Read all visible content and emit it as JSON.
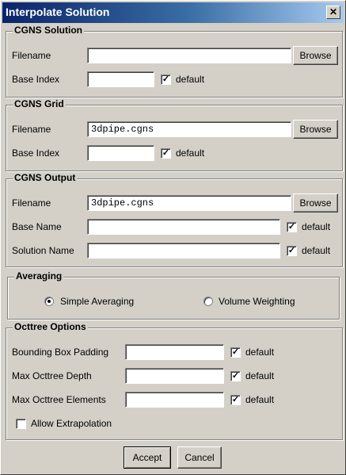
{
  "window": {
    "title": "Interpolate Solution",
    "close_glyph": "✕"
  },
  "cgns_solution": {
    "legend": "CGNS Solution",
    "filename_label": "Filename",
    "filename_value": "",
    "browse_label": "Browse",
    "base_index_label": "Base Index",
    "base_index_value": "",
    "default_label": "default",
    "default_checked": true
  },
  "cgns_grid": {
    "legend": "CGNS Grid",
    "filename_label": "Filename",
    "filename_value": "3dpipe.cgns",
    "browse_label": "Browse",
    "base_index_label": "Base Index",
    "base_index_value": "",
    "default_label": "default",
    "default_checked": true
  },
  "cgns_output": {
    "legend": "CGNS Output",
    "filename_label": "Filename",
    "filename_value": "3dpipe.cgns",
    "browse_label": "Browse",
    "base_name_label": "Base Name",
    "base_name_value": "",
    "base_name_default_label": "default",
    "solution_name_label": "Solution Name",
    "solution_name_value": "",
    "solution_name_default_label": "default"
  },
  "averaging": {
    "legend": "Averaging",
    "simple_label": "Simple Averaging",
    "simple_selected": true,
    "volume_label": "Volume Weighting",
    "volume_selected": false
  },
  "octtree": {
    "legend": "Octtree Options",
    "bbox_label": "Bounding Box Padding",
    "bbox_value": "",
    "bbox_default_label": "default",
    "depth_label": "Max Octtree Depth",
    "depth_value": "",
    "depth_default_label": "default",
    "elements_label": "Max Octtree Elements",
    "elements_value": "",
    "elements_default_label": "default",
    "extrapolation_label": "Allow Extrapolation",
    "extrapolation_checked": false
  },
  "footer": {
    "accept_label": "Accept",
    "cancel_label": "Cancel"
  },
  "glyphs": {
    "check": "✓"
  }
}
